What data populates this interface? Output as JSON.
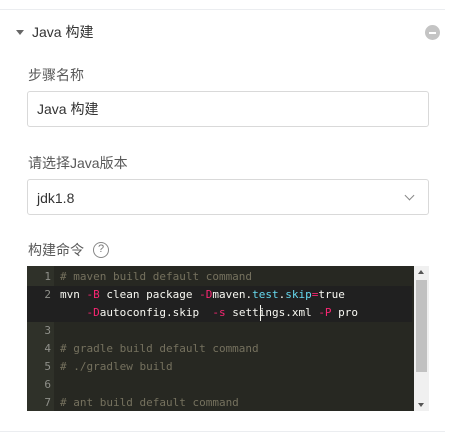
{
  "section": {
    "title": "Java 构建"
  },
  "fields": {
    "step_name_label": "步骤名称",
    "step_name_value": "Java 构建",
    "java_version_label": "请选择Java版本",
    "java_version_value": "jdk1.8",
    "build_command_label": "构建命令",
    "help_glyph": "?"
  },
  "editor": {
    "lines": [
      {
        "n": "1",
        "tokens": [
          {
            "t": "c",
            "v": "# maven build default command"
          }
        ]
      },
      {
        "n": "2",
        "tokens": [
          {
            "t": "p",
            "v": "mvn "
          },
          {
            "t": "f",
            "v": "-B"
          },
          {
            "t": "p",
            "v": " clean package "
          },
          {
            "t": "f",
            "v": "-D"
          },
          {
            "t": "p",
            "v": "maven."
          },
          {
            "t": "k",
            "v": "test"
          },
          {
            "t": "p",
            "v": "."
          },
          {
            "t": "k",
            "v": "skip"
          },
          {
            "t": "f",
            "v": "="
          },
          {
            "t": "p",
            "v": "true"
          }
        ]
      },
      {
        "n": "",
        "tokens": [
          {
            "t": "p",
            "v": "    "
          },
          {
            "t": "f",
            "v": "-D"
          },
          {
            "t": "p",
            "v": "autoconfig.skip  "
          },
          {
            "t": "f",
            "v": "-s"
          },
          {
            "t": "p",
            "v": " settings.xml "
          },
          {
            "t": "f",
            "v": "-P"
          },
          {
            "t": "p",
            "v": " pro"
          }
        ]
      },
      {
        "n": "3",
        "tokens": []
      },
      {
        "n": "4",
        "tokens": [
          {
            "t": "c",
            "v": "# gradle build default command"
          }
        ]
      },
      {
        "n": "5",
        "tokens": [
          {
            "t": "c",
            "v": "# ./gradlew build"
          }
        ]
      },
      {
        "n": "6",
        "tokens": []
      },
      {
        "n": "7",
        "tokens": [
          {
            "t": "c",
            "v": "# ant build default command"
          }
        ]
      }
    ],
    "active_rows": [
      1,
      2
    ]
  }
}
